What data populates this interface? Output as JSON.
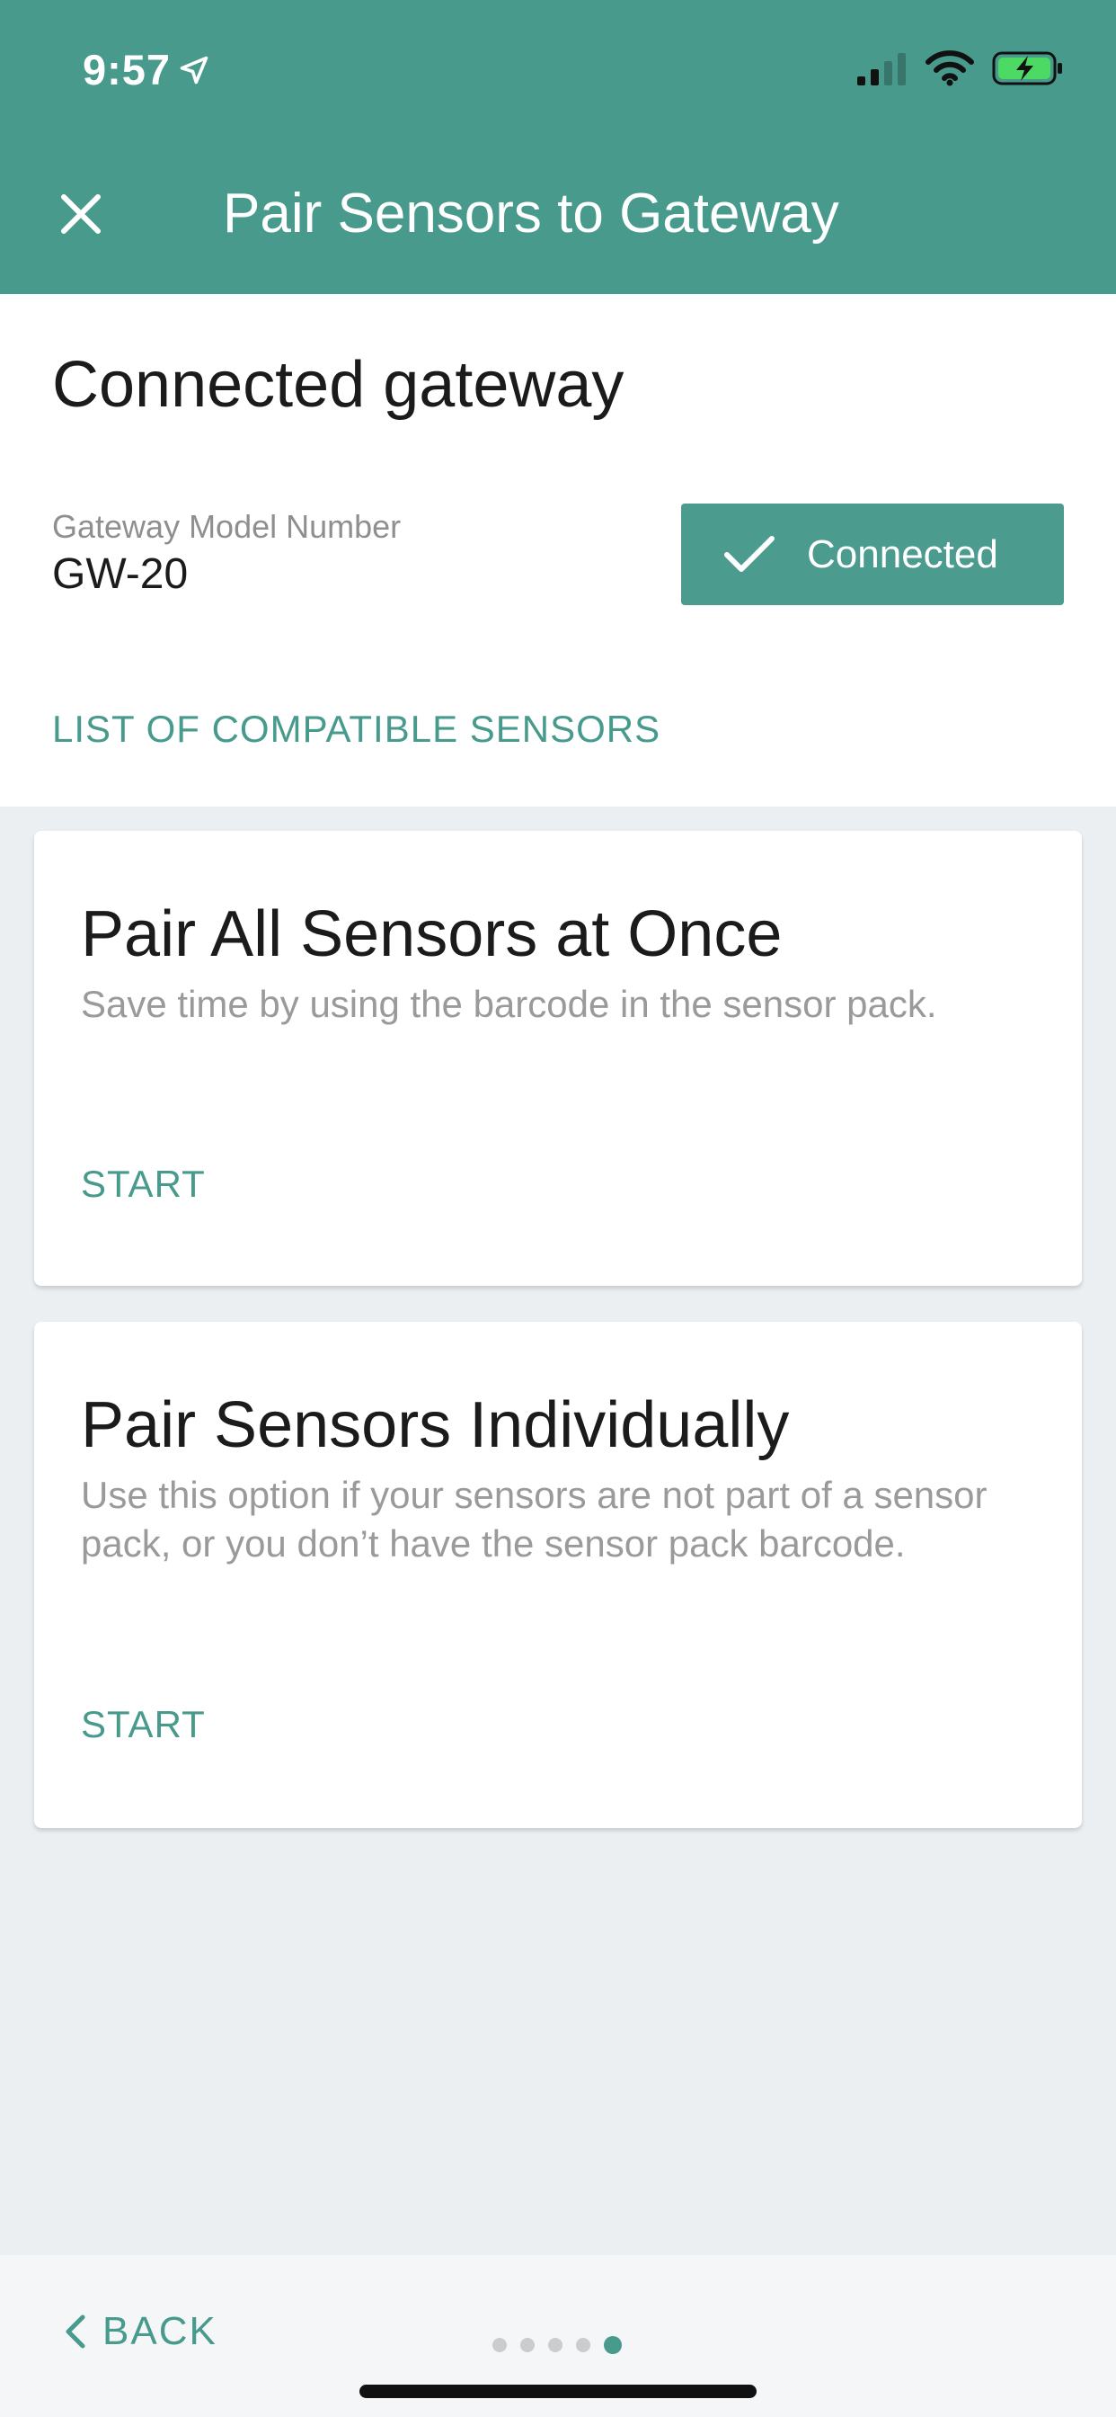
{
  "status_bar": {
    "time": "9:57"
  },
  "header": {
    "title": "Pair Sensors to Gateway",
    "bg_color": "#479a8c"
  },
  "gateway": {
    "section_title": "Connected gateway",
    "model_label": "Gateway Model Number",
    "model_value": "GW-20",
    "status_label": "Connected",
    "compatible_link": "LIST OF COMPATIBLE SENSORS"
  },
  "cards": [
    {
      "title": "Pair All Sensors at Once",
      "description": "Save time by using the barcode in the sensor pack.",
      "action": "START"
    },
    {
      "title": "Pair Sensors Individually",
      "description": "Use this option if your sensors are not part of a sensor pack, or you don’t have the sensor pack barcode.",
      "action": "START"
    }
  ],
  "footer": {
    "back_label": "BACK",
    "page_count": 5,
    "current_page": 5
  },
  "colors": {
    "accent": "#479a8c",
    "background": "#ebeff1"
  }
}
